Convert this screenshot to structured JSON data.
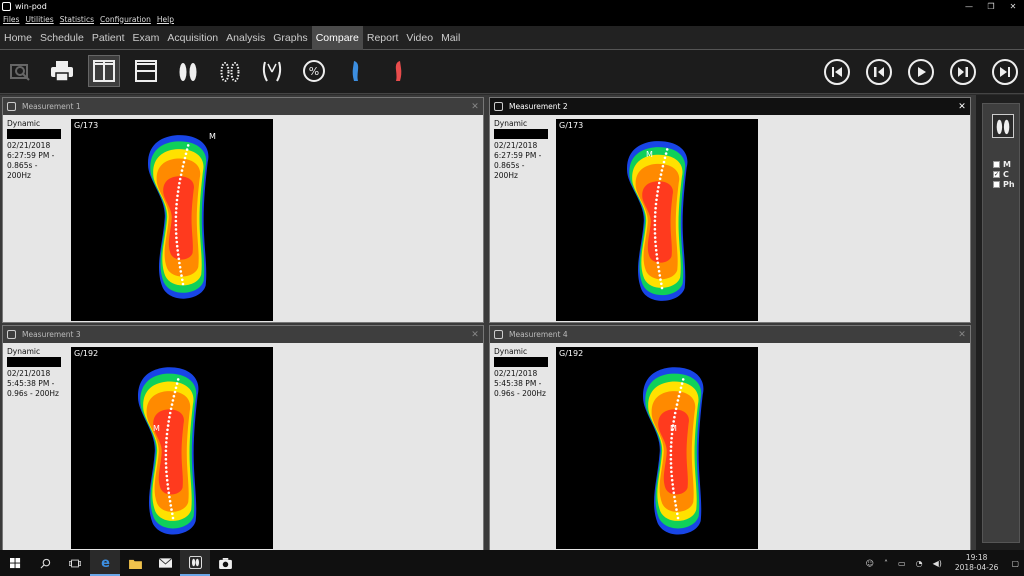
{
  "window": {
    "title": "win-pod",
    "minimize": "—",
    "restore": "❐",
    "close": "✕"
  },
  "menu": [
    "Files",
    "Utilities",
    "Statistics",
    "Configuration",
    "Help"
  ],
  "nav": [
    "Home",
    "Schedule",
    "Patient",
    "Exam",
    "Acquisition",
    "Analysis",
    "Graphs",
    "Compare",
    "Report",
    "Video",
    "Mail"
  ],
  "nav_active": "Compare",
  "toolbar_icons": [
    "search-measurement-icon",
    "printer-icon",
    "split-vertical-icon",
    "split-horizontal-icon",
    "feet-icon",
    "dotted-feet-icon",
    "foot-outline-icon",
    "percent-icon",
    "left-foot-blue-icon",
    "right-foot-red-icon"
  ],
  "playback_icons": [
    "skip-to-start-icon",
    "step-back-icon",
    "play-icon",
    "step-forward-icon",
    "skip-to-end-icon"
  ],
  "panels": [
    {
      "title": "Measurement 1",
      "type": "Dynamic",
      "date": "02/21/2018",
      "time": "6:27:59 PM -",
      "duration": "0.865s -",
      "rate": "200Hz",
      "label": "G/173",
      "marker": "M",
      "foot": "right"
    },
    {
      "title": "Measurement 2",
      "type": "Dynamic",
      "date": "02/21/2018",
      "time": "6:27:59 PM -",
      "duration": "0.865s -",
      "rate": "200Hz",
      "label": "G/173",
      "marker": "M",
      "foot": "right"
    },
    {
      "title": "Measurement 3",
      "type": "Dynamic",
      "date": "02/21/2018",
      "time": "5:45:38 PM -",
      "duration": "0.96s - 200Hz",
      "rate": "",
      "label": "G/192",
      "marker": "M",
      "foot": "right"
    },
    {
      "title": "Measurement 4",
      "type": "Dynamic",
      "date": "02/21/2018",
      "time": "5:45:38 PM -",
      "duration": "0.96s - 200Hz",
      "rate": "",
      "label": "G/192",
      "marker": "M",
      "foot": "right"
    }
  ],
  "side_options": [
    {
      "label": "M",
      "checked": false
    },
    {
      "label": "C",
      "checked": true
    },
    {
      "label": "Ph",
      "checked": false
    }
  ],
  "taskbar": {
    "time": "19:18",
    "date": "2018-04-26",
    "apps": [
      "start-icon",
      "search-icon",
      "task-view-icon",
      "edge-icon",
      "file-explorer-icon",
      "mail-icon",
      "win-pod-icon",
      "camera-icon"
    ]
  },
  "colors": {
    "accent_blue": "#3c8ee0",
    "accent_red": "#e84c4c"
  }
}
